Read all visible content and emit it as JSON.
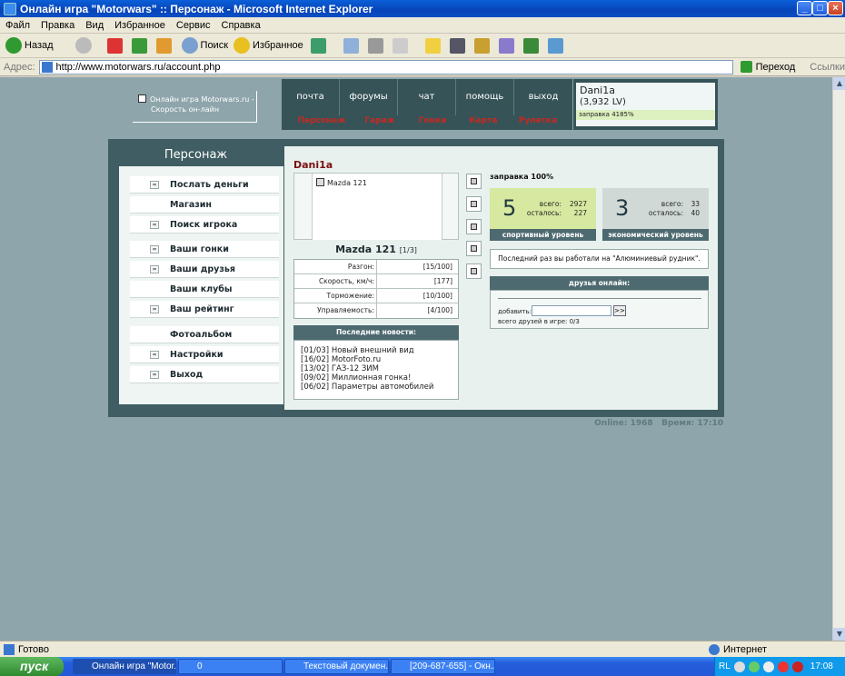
{
  "window": {
    "title": "Онлайн игра \"Motorwars\" :: Персонаж - Microsoft Internet Explorer",
    "btn_min": "_",
    "btn_max": "□",
    "btn_close": "×"
  },
  "menu": [
    "Файл",
    "Правка",
    "Вид",
    "Избранное",
    "Сервис",
    "Справка"
  ],
  "toolbar": {
    "back": "Назад",
    "search": "Поиск",
    "favorites": "Избранное"
  },
  "address": {
    "label": "Адрес:",
    "url": "http://www.motorwars.ru/account.php",
    "go": "Переход",
    "links": "Ссылки"
  },
  "logo": {
    "line1": "Онлайн игра Motorwars.ru -",
    "line2": "Скорость он-лайн"
  },
  "nav": {
    "top": [
      "почта",
      "форумы",
      "чат",
      "помощь",
      "выход"
    ],
    "sub": [
      "Персонаж",
      "Гараж",
      "Гонки",
      "Карта",
      "Рулетка"
    ]
  },
  "user": {
    "name": "Dani1a",
    "level": "(3,932 LV)",
    "fuel": "заправка 4185%"
  },
  "left": {
    "title": "Персонаж",
    "items": [
      {
        "label": "Послать деньги",
        "icon": true
      },
      {
        "label": "Магазин",
        "icon": false
      },
      {
        "label": "Поиск игрока",
        "icon": true
      },
      {
        "label": "Ваши гонки",
        "icon": true
      },
      {
        "label": "Ваши друзья",
        "icon": true
      },
      {
        "label": "Ваши клубы",
        "icon": false
      },
      {
        "label": "Ваш рейтинг",
        "icon": true
      },
      {
        "label": "Фотоальбом",
        "icon": false
      },
      {
        "label": "Настройки",
        "icon": true
      },
      {
        "label": "Выход",
        "icon": true
      }
    ]
  },
  "character": {
    "name": "Dani1a"
  },
  "car": {
    "list_item": "Mazda 121",
    "name": "Mazda 121",
    "index": "[1/3]",
    "stats": [
      {
        "label": "Разгон:",
        "value": "[15/100]"
      },
      {
        "label": "Скорость, км/ч:",
        "value": "[177]"
      },
      {
        "label": "Торможение:",
        "value": "[10/100]"
      },
      {
        "label": "Управляемость:",
        "value": "[4/100]"
      }
    ]
  },
  "news": {
    "header": "Последние новости:",
    "items": [
      "[01/03] Новый внешний вид",
      "[16/02] MotorFoto.ru",
      "[13/02] ГАЗ-12 ЗИМ",
      "[09/02] Миллионная гонка!",
      "[06/02] Параметры автомобилей"
    ]
  },
  "fuel": {
    "label": "заправка 100%"
  },
  "sport": {
    "level": "5",
    "total_label": "всего:",
    "total": "2927",
    "left_label": "осталось:",
    "left": "227",
    "caption": "спортивный уровень"
  },
  "econ": {
    "level": "3",
    "total_label": "всего:",
    "total": "33",
    "left_label": "осталось:",
    "left": "40",
    "caption": "экономический уровень"
  },
  "lastwork": "Последний раз вы работали на \"Алюминиевый рудник\".",
  "friends": {
    "header": "друзья онлайн:",
    "add_label": "добавить:",
    "go": ">>",
    "total": "всего друзей в игре: 0/3"
  },
  "footer": {
    "online": "Online: 1968",
    "time": "Время: 17:10"
  },
  "status": {
    "text": "Готово",
    "zone": "Интернет"
  },
  "taskbar": {
    "start": "пуск",
    "tasks": [
      "Онлайн игра \"Motor...",
      "0",
      "Текстовый докумен...",
      "[209-687-655] - Окн..."
    ],
    "lang": "RL",
    "clock": "17:08"
  },
  "colors": {
    "frame": "#3f5d62",
    "page_bg": "#8ea5ab",
    "nav_red": "#c82820",
    "sport_bg": "#d7e8a0"
  }
}
